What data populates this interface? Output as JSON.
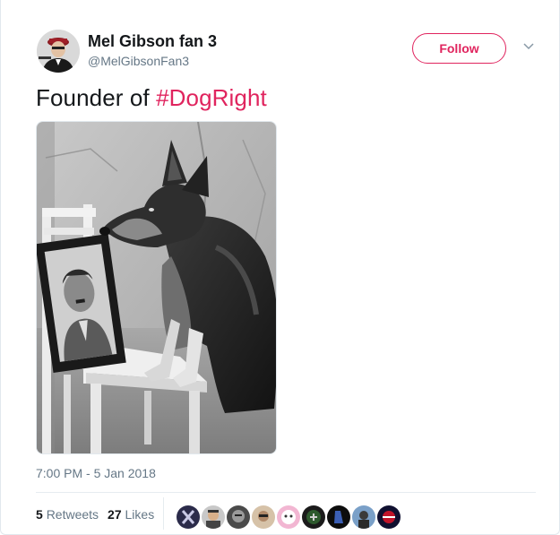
{
  "tweet": {
    "author": {
      "display_name": "Mel Gibson fan 3",
      "handle": "@MelGibsonFan3"
    },
    "follow_label": "Follow",
    "text_prefix": "Founder of ",
    "hashtag": "#DogRight",
    "timestamp": "7:00 PM - 5 Jan 2018",
    "stats": {
      "retweets_count": "5",
      "retweets_label": "Retweets",
      "likes_count": "27",
      "likes_label": "Likes"
    },
    "liker_avatars": [
      "liker-avatar-1",
      "liker-avatar-2",
      "liker-avatar-3",
      "liker-avatar-4",
      "liker-avatar-5",
      "liker-avatar-6",
      "liker-avatar-7",
      "liker-avatar-8",
      "liker-avatar-9"
    ]
  },
  "colors": {
    "accent": "#e0245e",
    "secondary_text": "#657786",
    "primary_text": "#14171a",
    "border": "#e1e8ed"
  }
}
